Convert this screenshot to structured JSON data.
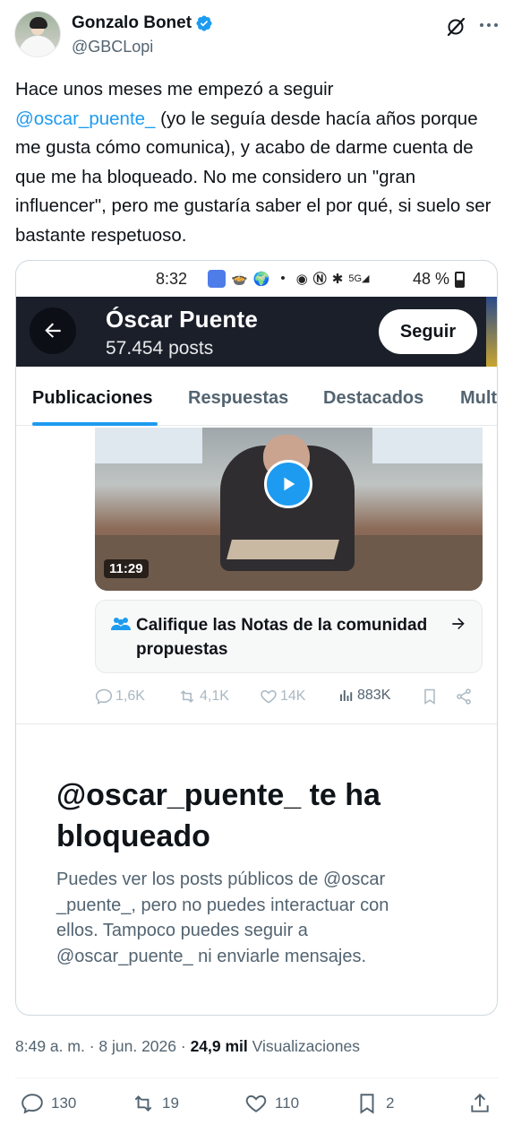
{
  "author": {
    "name": "Gonzalo Bonet",
    "handle": "@GBCLopi"
  },
  "tweet": {
    "text_before_mention": "Hace unos meses me empezó a seguir",
    "mention": "@oscar_puente_",
    "text_after_mention": " (yo le seguía desde hacía años porque me gusta cómo comunica), y acabo de darme cuenta de que me ha bloqueado. No me considero un \"gran influencer\", pero me gustaría saber el por qué, si suelo ser bastante respetuoso."
  },
  "screenshot": {
    "status_bar": {
      "time": "8:32",
      "signal": "5G",
      "battery": "48 %"
    },
    "profile": {
      "name": "Óscar Puente",
      "posts": "57.454 posts",
      "follow_label": "Seguir"
    },
    "tabs": [
      "Publicaciones",
      "Respuestas",
      "Destacados",
      "Mult"
    ],
    "active_tab": 0,
    "video": {
      "duration": "11:29"
    },
    "community_notes": {
      "label": "Califique las Notas de la comunidad propuestas"
    },
    "inner_actions": {
      "replies": "1,6K",
      "reposts": "4,1K",
      "likes": "14K",
      "views": "883K"
    },
    "blocked": {
      "title": "@oscar_puente_ te ha bloqueado",
      "description": "Puedes ver los posts públicos de @oscar _puente_, pero no puedes interactuar con ellos. Tampoco puedes seguir a @oscar_puente_ ni enviarle mensajes."
    }
  },
  "meta": {
    "time": "8:49 a. m.",
    "date": "8 jun. 2026",
    "views_count": "24,9 mil",
    "views_label": "Visualizaciones"
  },
  "actions": {
    "replies": "130",
    "reposts": "19",
    "likes": "110",
    "bookmarks": "2"
  },
  "colors": {
    "accent": "#1d9bf0",
    "text": "#0f1419",
    "secondary": "#536471"
  }
}
